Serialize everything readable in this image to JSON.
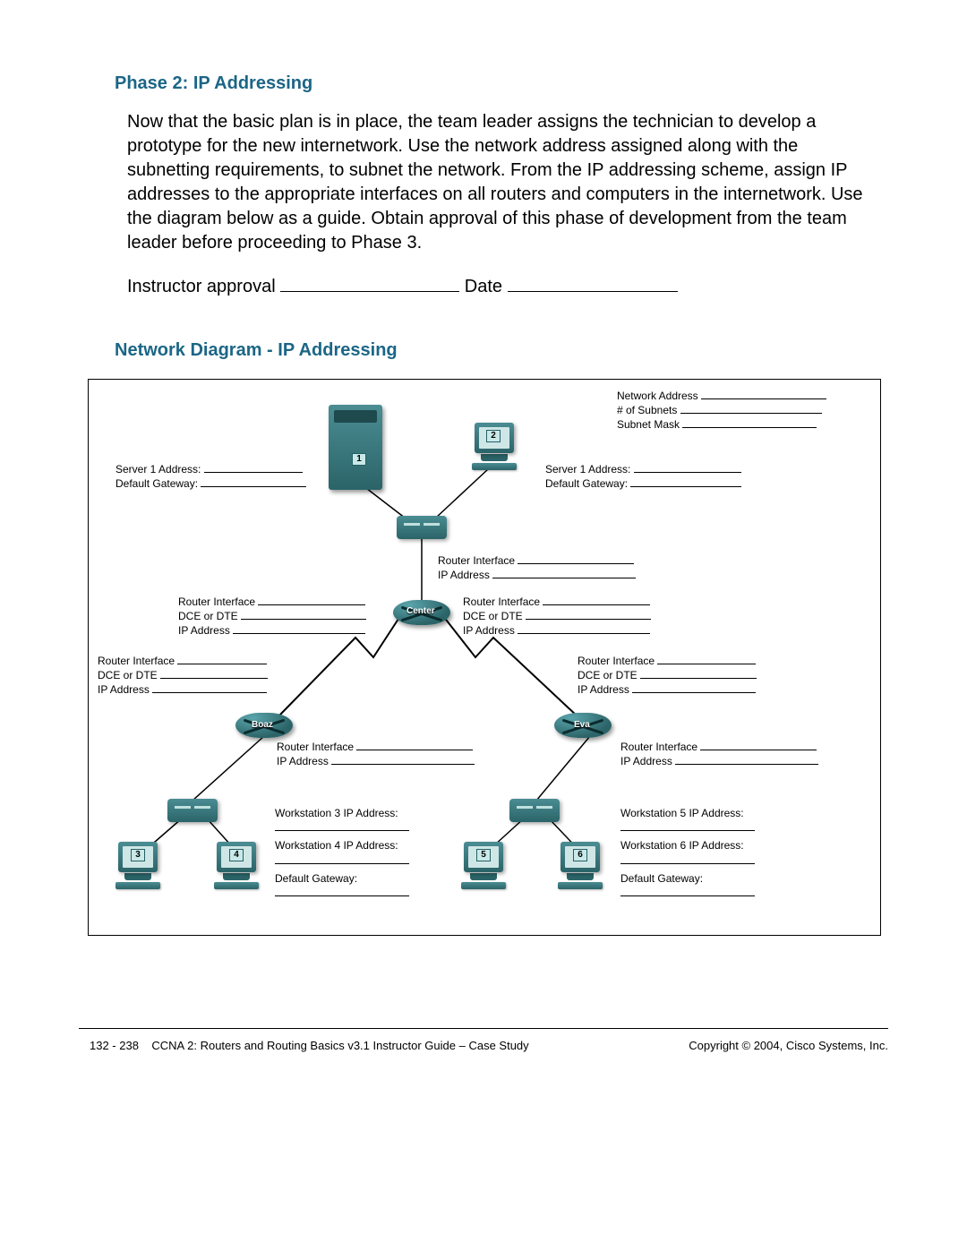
{
  "section1_title": "Phase 2: IP Addressing",
  "body_text": "Now that the basic plan is in place, the team leader assigns the technician to develop a prototype for the new internetwork. Use the network address assigned along with the subnetting requirements, to subnet the network. From the IP addressing scheme, assign IP addresses to the appropriate interfaces on all routers and computers in the internetwork. Use the diagram below as a guide. Obtain approval of this phase of development from the team leader before proceeding to Phase 3.",
  "approval_label": "Instructor approval",
  "date_label": "Date",
  "section2_title": "Network Diagram - IP Addressing",
  "diagram": {
    "top_right": {
      "net_addr": "Network Address",
      "num_subnets": "# of Subnets",
      "subnet_mask": "Subnet Mask"
    },
    "server_left": {
      "addr": "Server 1 Address:",
      "gw": "Default Gateway:"
    },
    "server_right": {
      "addr": "Server 1 Address:",
      "gw": "Default Gateway:"
    },
    "router_iface": "Router Interface",
    "ip_address": "IP Address",
    "dce_dte": "DCE or DTE",
    "routers": {
      "center": "Center",
      "boaz": "Boaz",
      "eva": "Eva"
    },
    "ws": {
      "ws3": "Workstation 3 IP Address:",
      "ws4": "Workstation 4 IP Address:",
      "ws5": "Workstation 5 IP Address:",
      "ws6": "Workstation 6 IP Address:",
      "gw": "Default Gateway:"
    },
    "device_nums": {
      "n1": "1",
      "n2": "2",
      "n3": "3",
      "n4": "4",
      "n5": "5",
      "n6": "6"
    }
  },
  "footer": {
    "left_page": "132 - 238",
    "left_title": "CCNA 2: Routers and Routing Basics v3.1 Instructor Guide – Case Study",
    "right": "Copyright © 2004, Cisco Systems, Inc."
  }
}
